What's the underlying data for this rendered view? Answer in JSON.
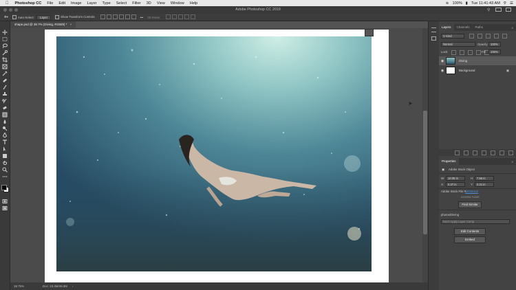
{
  "menubar": {
    "app_name": "Photoshop CC",
    "items": [
      "File",
      "Edit",
      "Image",
      "Layer",
      "Type",
      "Select",
      "Filter",
      "3D",
      "View",
      "Window",
      "Help"
    ],
    "battery": "100%",
    "clock": "Tue 11:41:43 AM"
  },
  "window": {
    "title": "Adobe Photoshop CC 2019"
  },
  "options": {
    "auto_select_label": "Auto-Select:",
    "auto_select_value": "Layer",
    "transform_label": "Show Transform Controls",
    "mode_3d": "3D Mode:"
  },
  "document": {
    "tab_title": "shape.psd @ 38.7% (Diving, RGB/8) *",
    "zoom": "38.75%",
    "doc_info": "Doc: 23.4M/49.3M"
  },
  "layers_panel": {
    "tabs": [
      "Layers",
      "Channels",
      "Paths"
    ],
    "filter_kind": "Kind",
    "blend_mode": "Normal",
    "opacity_label": "Opacity:",
    "opacity": "100%",
    "lock_label": "Lock:",
    "fill_label": "Fill:",
    "fill": "100%",
    "layers": [
      {
        "name": "Diving",
        "selected": true
      },
      {
        "name": "Background",
        "selected": false
      }
    ]
  },
  "properties_panel": {
    "title": "Properties",
    "object_type": "Adobe Stock Object",
    "w_label": "W:",
    "w_value": "10.08 in",
    "h_label": "H:",
    "h_value": "7.56 in",
    "x_label": "X:",
    "x_value": "0.37 in",
    "y_label": "Y:",
    "y_value": "0.21 in",
    "stock_file_label": "Adobe Stock File #",
    "stock_file_id": "48785122",
    "license_btn": "License Asset",
    "find_similar_btn": "Find Similar",
    "path": "photos/Diving",
    "layer_comp_placeholder": "Don't Apply Layer Comp",
    "edit_contents_btn": "Edit Contents",
    "embed_btn": "Embed"
  },
  "colors": {
    "accent": "#4a90d9",
    "panel": "#434343",
    "app_bg": "#535353"
  }
}
